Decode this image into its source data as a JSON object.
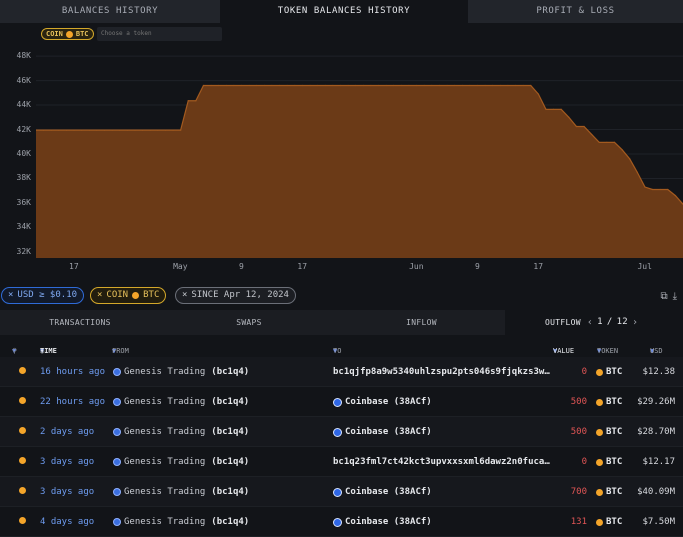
{
  "top_tabs": [
    "BALANCES HISTORY",
    "TOKEN BALANCES HISTORY",
    "PROFIT & LOSS"
  ],
  "token_selector": {
    "coin_label": "COIN",
    "token": "BTC",
    "placeholder": "Choose a token"
  },
  "chart_data": {
    "type": "area",
    "ylim": [
      31500,
      48500
    ],
    "yticks": [
      "48K",
      "46K",
      "44K",
      "42K",
      "40K",
      "38K",
      "36K",
      "34K",
      "32K"
    ],
    "xticks": [
      "17",
      "May",
      "9",
      "17",
      "Jun",
      "9",
      "17",
      "Jul"
    ],
    "x": [
      "Apr 12",
      "Apr 13",
      "Apr 14",
      "Apr 15",
      "Apr 16",
      "Apr 17",
      "Apr 18",
      "Apr 19",
      "Apr 20",
      "Apr 21",
      "Apr 22",
      "Apr 23",
      "Apr 24",
      "Apr 25",
      "Apr 26",
      "Apr 27",
      "Apr 28",
      "Apr 29",
      "Apr 30",
      "May 1",
      "May 2",
      "May 3",
      "May 4",
      "May 5",
      "May 6",
      "May 7",
      "May 8",
      "May 9",
      "May 10",
      "May 11",
      "May 12",
      "May 13",
      "May 14",
      "May 15",
      "May 16",
      "May 17",
      "May 18",
      "May 19",
      "May 20",
      "May 21",
      "May 22",
      "May 23",
      "May 24",
      "May 25",
      "May 26",
      "May 27",
      "May 28",
      "May 29",
      "May 30",
      "May 31",
      "Jun 1",
      "Jun 2",
      "Jun 3",
      "Jun 4",
      "Jun 5",
      "Jun 6",
      "Jun 7",
      "Jun 8",
      "Jun 9",
      "Jun 10",
      "Jun 11",
      "Jun 12",
      "Jun 13",
      "Jun 14",
      "Jun 15",
      "Jun 16",
      "Jun 17",
      "Jun 18",
      "Jun 19",
      "Jun 20",
      "Jun 21",
      "Jun 22",
      "Jun 23",
      "Jun 24",
      "Jun 25",
      "Jun 26",
      "Jun 27",
      "Jun 28",
      "Jun 29",
      "Jun 30",
      "Jul 1",
      "Jul 2",
      "Jul 3"
    ],
    "values": [
      41950,
      41950,
      41950,
      41950,
      41950,
      41950,
      41950,
      41950,
      41950,
      41950,
      41950,
      41950,
      41950,
      41950,
      41950,
      41950,
      41950,
      41950,
      41950,
      41950,
      44350,
      44350,
      45600,
      45600,
      45600,
      45600,
      45600,
      45600,
      45600,
      45600,
      45600,
      45600,
      45600,
      45600,
      45600,
      45600,
      45600,
      45600,
      45600,
      45600,
      45600,
      45600,
      45600,
      45600,
      45600,
      45600,
      45600,
      45600,
      45600,
      45600,
      45600,
      45600,
      45600,
      45600,
      45600,
      45600,
      45600,
      45600,
      45600,
      45600,
      45600,
      45600,
      45600,
      45600,
      45600,
      45600,
      44900,
      43650,
      43650,
      43650,
      43000,
      42250,
      42250,
      41600,
      40950,
      40950,
      40950,
      40350,
      39600,
      38500,
      37300,
      37100,
      37100,
      37100,
      36600,
      35900
    ],
    "line_color": "#a35a1f",
    "fill_color": "#6b3a17"
  },
  "filters": {
    "usd": "USD ≥ $0.10",
    "coin": "COIN",
    "coin_token": "BTC",
    "since": "SINCE Apr 12, 2024"
  },
  "section_tabs": [
    "TRANSACTIONS",
    "SWAPS",
    "INFLOW",
    "OUTFLOW"
  ],
  "pager": {
    "current": "1",
    "total": "12"
  },
  "columns": {
    "time": "TIME",
    "from": "FROM",
    "to": "TO",
    "value": "VALUE",
    "token": "TOKEN",
    "usd": "USD"
  },
  "transactions": [
    {
      "time": "16 hours ago",
      "from": "Genesis Trading",
      "from_addr": "(bc1q4)",
      "to": "bc1qjfp8a9w5340uhlzspu2pts046s9fjqkzs3w…",
      "to_is_entity": false,
      "value": "0",
      "token": "BTC",
      "usd": "$12.38"
    },
    {
      "time": "22 hours ago",
      "from": "Genesis Trading",
      "from_addr": "(bc1q4)",
      "to": "Coinbase (38ACf)",
      "to_is_entity": true,
      "value": "500",
      "token": "BTC",
      "usd": "$29.26M"
    },
    {
      "time": "2 days ago",
      "from": "Genesis Trading",
      "from_addr": "(bc1q4)",
      "to": "Coinbase (38ACf)",
      "to_is_entity": true,
      "value": "500",
      "token": "BTC",
      "usd": "$28.70M"
    },
    {
      "time": "3 days ago",
      "from": "Genesis Trading",
      "from_addr": "(bc1q4)",
      "to": "bc1q23fml7ct42kct3upvxxsxml6dawz2n0fuca…",
      "to_is_entity": false,
      "value": "0",
      "token": "BTC",
      "usd": "$12.17"
    },
    {
      "time": "3 days ago",
      "from": "Genesis Trading",
      "from_addr": "(bc1q4)",
      "to": "Coinbase (38ACf)",
      "to_is_entity": true,
      "value": "700",
      "token": "BTC",
      "usd": "$40.09M"
    },
    {
      "time": "4 days ago",
      "from": "Genesis Trading",
      "from_addr": "(bc1q4)",
      "to": "Coinbase (38ACf)",
      "to_is_entity": true,
      "value": "131",
      "token": "BTC",
      "usd": "$7.50M"
    }
  ]
}
